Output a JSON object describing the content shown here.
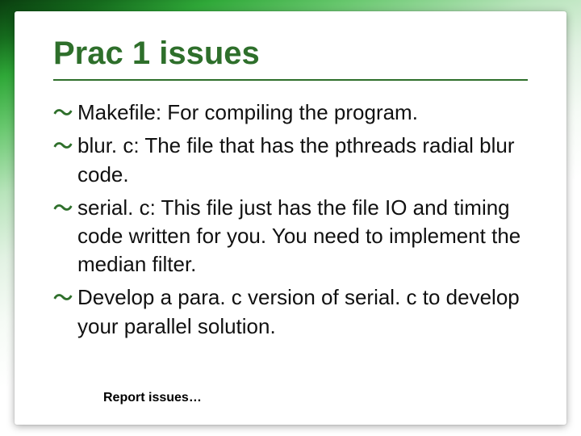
{
  "slide": {
    "title": "Prac 1 issues",
    "bullets": [
      {
        "label": "Makefile: For compiling the program."
      },
      {
        "label": "blur. c: The file that has the pthreads radial blur code."
      },
      {
        "label": "serial. c: This file just has the file IO and timing code written for you. You need to implement the median filter."
      },
      {
        "label": "Develop a para. c version of  serial. c to develop your parallel solution."
      }
    ],
    "footer": "Report issues…"
  }
}
